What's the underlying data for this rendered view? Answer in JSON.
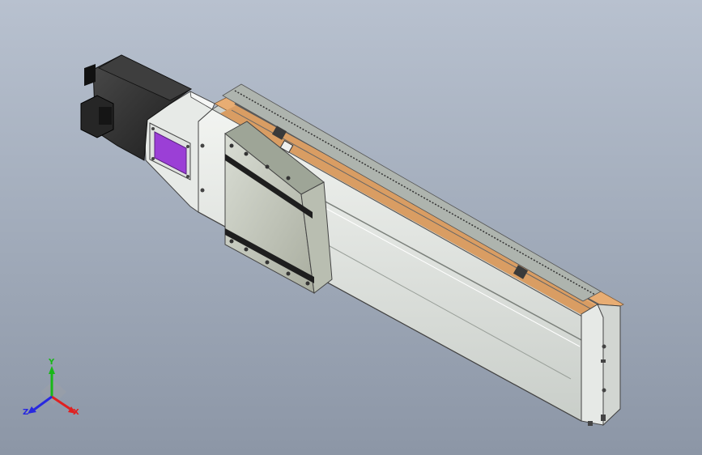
{
  "viewport": {
    "background_top": "#b8c1cf",
    "background_bottom": "#8c96a6"
  },
  "model": {
    "motor_color": "#2c2c2c",
    "flange_plate_color": "#9b3fd6",
    "rail_body_color": "#dfe3e0",
    "belt_cover_color": "#e8ad73",
    "carriage_color": "#c8cdc4"
  },
  "triad": {
    "x_label": "X",
    "y_label": "Y",
    "z_label": "Z",
    "x_color": "#e02020",
    "y_color": "#18b818",
    "z_color": "#2828e0"
  }
}
